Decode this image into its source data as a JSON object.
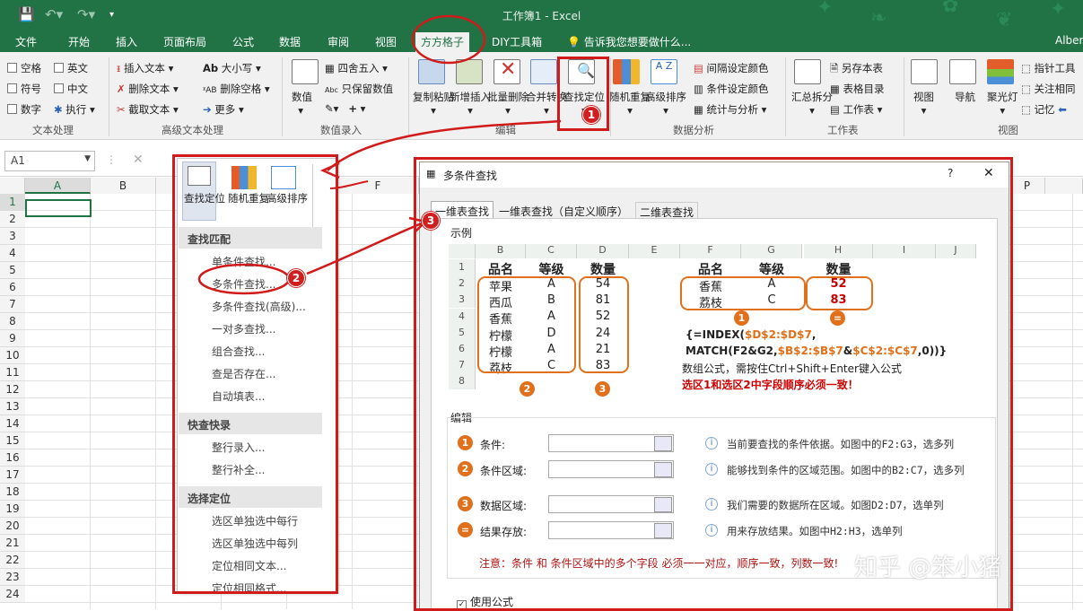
{
  "window": {
    "title": "工作簿1 - Excel",
    "user": "Alber"
  },
  "tabs": [
    "文件",
    "开始",
    "插入",
    "页面布局",
    "公式",
    "数据",
    "审阅",
    "视图",
    "方方格子",
    "DIY工具箱",
    "告诉我您想要做什么..."
  ],
  "ribbon": {
    "text_group": {
      "checks": [
        "空格",
        "英文",
        "符号",
        "中文",
        "数字"
      ],
      "exec": "执行",
      "label": "文本处理"
    },
    "adv_group": {
      "items": [
        "插入文本",
        "删除文本",
        "截取文本",
        "大小写",
        "删除空格",
        "更多"
      ],
      "label": "高级文本处理"
    },
    "num_group": {
      "items": [
        "四舍五入",
        "只保留数值",
        "数值"
      ],
      "label": "数值录入"
    },
    "edit_group": {
      "items": [
        "复制粘贴",
        "新增插入",
        "批量删除",
        "合并转换",
        "查找定位"
      ],
      "label": "编辑"
    },
    "analysis_group": {
      "items": [
        "随机重复",
        "高级排序",
        "间隔设定颜色",
        "条件设定颜色",
        "统计与分析"
      ],
      "label": "数据分析"
    },
    "work_group": {
      "items": [
        "汇总拆分",
        "另存本表",
        "表格目录",
        "工作表"
      ],
      "label": "工作表"
    },
    "view_group": {
      "items": [
        "视图",
        "导航",
        "聚光灯",
        "指针工具",
        "关注相同",
        "记忆"
      ],
      "label": "视图"
    }
  },
  "namebox": "A1",
  "columns": [
    "A",
    "B",
    "",
    "",
    "F",
    "",
    "",
    "",
    "",
    "",
    "",
    "",
    "",
    "",
    "",
    "P"
  ],
  "rows": [
    "1",
    "2",
    "3",
    "4",
    "5",
    "6",
    "7",
    "8",
    "9",
    "10",
    "11",
    "12",
    "13",
    "14",
    "15",
    "16",
    "17",
    "18",
    "19",
    "20",
    "21",
    "22",
    "23",
    "24"
  ],
  "dropdown": {
    "mini": [
      "查找定位",
      "随机重复",
      "高级排序"
    ],
    "sections": [
      {
        "title": "查找匹配",
        "items": [
          "单条件查找...",
          "多条件查找...",
          "多条件查找(高级)...",
          "一对多查找...",
          "组合查找...",
          "查是否存在...",
          "自动填表..."
        ]
      },
      {
        "title": "快查快录",
        "items": [
          "整行录入...",
          "整行补全..."
        ]
      },
      {
        "title": "选择定位",
        "items": [
          "选区单独选中每行",
          "选区单独选中每列",
          "定位相同文本...",
          "定位相同格式..."
        ]
      }
    ]
  },
  "dialog": {
    "title": "多条件查找",
    "help": "?",
    "close": "✕",
    "tabs": [
      "一维表查找",
      "一维表查找（自定义顺序）",
      "二维表查找"
    ],
    "example_label": "示例",
    "example": {
      "cols": [
        "B",
        "C",
        "D",
        "E",
        "F",
        "G",
        "H",
        "I",
        "J"
      ],
      "rows": [
        "1",
        "2",
        "3",
        "4",
        "5",
        "6",
        "7",
        "8"
      ],
      "left_header": [
        "品名",
        "等级",
        "数量"
      ],
      "left": [
        [
          "苹果",
          "A",
          "54"
        ],
        [
          "西瓜",
          "B",
          "81"
        ],
        [
          "香蕉",
          "A",
          "52"
        ],
        [
          "柠檬",
          "D",
          "24"
        ],
        [
          "柠檬",
          "A",
          "21"
        ],
        [
          "荔枝",
          "C",
          "83"
        ]
      ],
      "right_header": [
        "品名",
        "等级",
        "数量"
      ],
      "right": [
        [
          "香蕉",
          "A",
          "52"
        ],
        [
          "荔枝",
          "C",
          "83"
        ]
      ],
      "formula1a": "{=INDEX(",
      "formula1b": "$D$2:$D$7",
      ",": ",",
      "formula2a": "MATCH(F2&G2,",
      "formula2b": "$B$2:$B$7",
      "formula2c": "&",
      "formula2d": "$C$2:$C$7",
      "formula2e": ",0))}",
      "note1": "数组公式，需按住Ctrl+Shift+Enter键入公式",
      "note2": "选区1和选区2中字段顺序必须一致！",
      "badges": [
        "1",
        "2",
        "3",
        "="
      ]
    },
    "edit_label": "编辑",
    "fields": [
      {
        "label": "条件:",
        "hint": "当前要查找的条件依据。如图中的F2:G3，选多列"
      },
      {
        "label": "条件区域:",
        "hint": "能够找到条件的区域范围。如图中的B2:C7，选多列"
      },
      {
        "label": "数据区域:",
        "hint": "我们需要的数据所在区域。如图D2:D7，选单列"
      },
      {
        "label": "结果存放:",
        "hint": "用来存放结果。如图中H2:H3，选单列"
      }
    ],
    "warning": "注意：条件 和 条件区域中的多个字段 必须一一对应，顺序一致，列数一致!",
    "use_formula": "使用公式"
  },
  "callouts": [
    "1",
    "2",
    "3"
  ],
  "watermark": "知乎 @笨小猪",
  "colors": {
    "excel_green": "#217346",
    "annot_red": "#d11a1a",
    "badge_orange": "#e0701b"
  }
}
